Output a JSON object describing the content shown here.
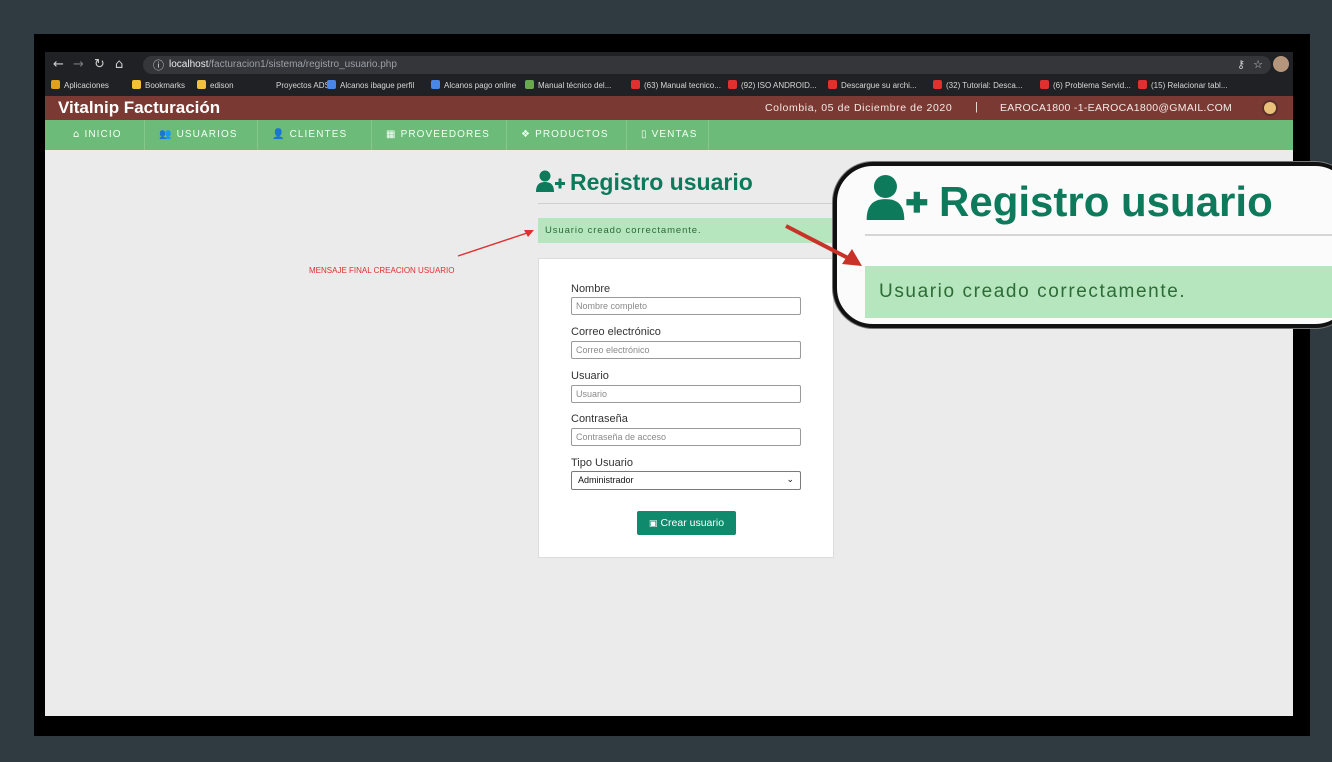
{
  "browser": {
    "url_host": "localhost",
    "url_path": "/facturacion1/sistema/registro_usuario.php",
    "bookmarks": [
      {
        "label": "Aplicaciones",
        "color": "#e0a020"
      },
      {
        "label": "Bookmarks",
        "color": "#f1c232"
      },
      {
        "label": "edison",
        "color": "#f0c040"
      },
      {
        "label": "Proyectos ADSI",
        "color": "#202124"
      },
      {
        "label": "Alcanos ibague perfil",
        "color": "#4a86e8"
      },
      {
        "label": "Alcanos pago online",
        "color": "#4a86e8"
      },
      {
        "label": "Manual técnico del...",
        "color": "#6aa84f"
      },
      {
        "label": "(63) Manual tecnico...",
        "color": "#e03030"
      },
      {
        "label": "(92) ISO ANDROID...",
        "color": "#e03030"
      },
      {
        "label": "Descargue su archi...",
        "color": "#e03030"
      },
      {
        "label": "(32) Tutorial: Desca...",
        "color": "#e03030"
      },
      {
        "label": "(6) Problema Servid...",
        "color": "#e03030"
      },
      {
        "label": "(15) Relacionar tabl...",
        "color": "#e03030"
      }
    ]
  },
  "header": {
    "brand": "Vitalnip Facturación",
    "location_date": "Colombia, 05 de Diciembre de 2020",
    "separator": "|",
    "user": "EAROCA1800 -1-EAROCA1800@GMAIL.COM"
  },
  "nav": [
    {
      "label": "INICIO",
      "icon": "home-icon",
      "glyph": "⌂"
    },
    {
      "label": "USUARIOS",
      "icon": "users-icon",
      "glyph": "👥"
    },
    {
      "label": "CLIENTES",
      "icon": "user-icon",
      "glyph": "👤"
    },
    {
      "label": "PROVEEDORES",
      "icon": "building-icon",
      "glyph": "▦"
    },
    {
      "label": "PRODUCTOS",
      "icon": "cubes-icon",
      "glyph": "❖"
    },
    {
      "label": "VENTAS",
      "icon": "file-icon",
      "glyph": "▯"
    }
  ],
  "page": {
    "title": "Registro usuario",
    "alert": "Usuario creado correctamente.",
    "annotation": "MENSAJE FINAL CREACION USUARIO"
  },
  "form": {
    "nombre_label": "Nombre",
    "nombre_placeholder": "Nombre completo",
    "correo_label": "Correo electrónico",
    "correo_placeholder": "Correo electrónico",
    "usuario_label": "Usuario",
    "usuario_placeholder": "Usuario",
    "clave_label": "Contraseña",
    "clave_placeholder": "Contraseña de acceso",
    "tipo_label": "Tipo Usuario",
    "tipo_selected": "Administrador",
    "submit_label": "Crear usuario"
  },
  "colors": {
    "header_bg": "#7a3a33",
    "nav_bg": "#6dbb78",
    "accent": "#0e7a5c",
    "alert_bg": "#b6e6bd",
    "button_bg": "#108a6c",
    "annotation": "#e03030"
  }
}
